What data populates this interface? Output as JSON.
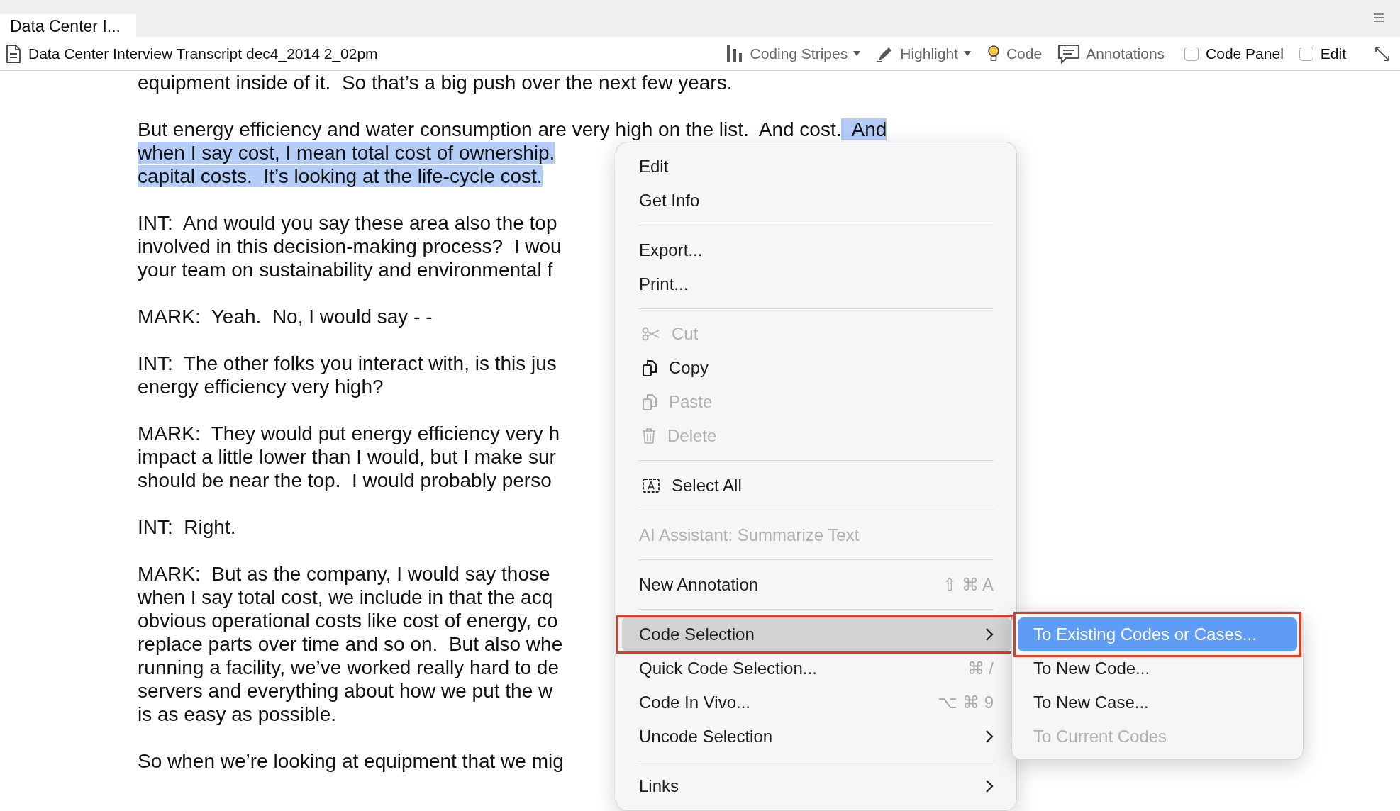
{
  "tab": {
    "title": "Data Center I..."
  },
  "toolbar": {
    "document_title": "Data Center Interview Transcript dec4_2014 2_02pm",
    "tools": [
      {
        "kind": "stripes",
        "label": "Coding Stripes",
        "dropdown": true
      },
      {
        "kind": "highlight",
        "label": "Highlight",
        "dropdown": true
      },
      {
        "kind": "code",
        "label": "Code",
        "dropdown": false
      },
      {
        "kind": "annotations",
        "label": "Annotations",
        "dropdown": false
      }
    ],
    "checkboxes": [
      {
        "label": "Code Panel",
        "checked": false
      },
      {
        "label": "Edit",
        "checked": false
      }
    ]
  },
  "transcript": [
    {
      "lines": [
        [
          {
            "text": "equipment inside of it.  So that’s a big push over the next few years.",
            "highlighted": false
          }
        ]
      ]
    },
    {
      "lines": [
        [
          {
            "text": "But energy efficiency and water consumption are very high on the list.  And cost.",
            "highlighted": false
          },
          {
            "text": "  And",
            "highlighted": true
          }
        ],
        [
          {
            "text": "when I say cost, I mean total cost of ownership.",
            "highlighted": true
          }
        ],
        [
          {
            "text": "capital costs.  It’s looking at the life-cycle cost.",
            "highlighted": true
          }
        ]
      ]
    },
    {
      "lines": [
        [
          {
            "text": "INT:  And would you say these area also the top",
            "highlighted": false
          }
        ],
        [
          {
            "text": "involved in this decision-making process?  I wou",
            "highlighted": false
          }
        ],
        [
          {
            "text": "your team on sustainability and environmental f",
            "highlighted": false
          }
        ]
      ]
    },
    {
      "lines": [
        [
          {
            "text": "MARK:  Yeah.  No, I would say - -",
            "highlighted": false
          }
        ]
      ]
    },
    {
      "lines": [
        [
          {
            "text": "INT:  The other folks you interact with, is this jus",
            "highlighted": false
          }
        ],
        [
          {
            "text": "energy efficiency very high?",
            "highlighted": false
          }
        ]
      ]
    },
    {
      "lines": [
        [
          {
            "text": "MARK:  They would put energy efficiency very h",
            "highlighted": false
          }
        ],
        [
          {
            "text": "impact a little lower than I would, but I make sur",
            "highlighted": false
          }
        ],
        [
          {
            "text": "should be near the top.  I would probably perso",
            "highlighted": false
          }
        ]
      ]
    },
    {
      "lines": [
        [
          {
            "text": "INT:  Right.",
            "highlighted": false
          }
        ]
      ]
    },
    {
      "lines": [
        [
          {
            "text": "MARK:  But as the company, I would say those",
            "highlighted": false
          }
        ],
        [
          {
            "text": "when I say total cost, we include in that the acq",
            "highlighted": false
          }
        ],
        [
          {
            "text": "obvious operational costs like cost of energy, co",
            "highlighted": false
          }
        ],
        [
          {
            "text": "replace parts over time and so on.  But also whe",
            "highlighted": false
          }
        ],
        [
          {
            "text": "running a facility, we’ve worked really hard to de",
            "highlighted": false
          }
        ],
        [
          {
            "text": "servers and everything about how we put the w",
            "highlighted": false
          }
        ],
        [
          {
            "text": "is as easy as possible.",
            "highlighted": false
          }
        ]
      ]
    },
    {
      "lines": [
        [
          {
            "text": "So when we’re looking at equipment that we mig",
            "highlighted": false
          }
        ]
      ]
    }
  ],
  "context_menu": {
    "items": [
      {
        "kind": "item",
        "label": "Edit",
        "disabled": false,
        "selected": false
      },
      {
        "kind": "item",
        "label": "Get Info",
        "disabled": false,
        "selected": false
      },
      {
        "kind": "separator"
      },
      {
        "kind": "item",
        "label": "Export...",
        "disabled": false,
        "selected": false
      },
      {
        "kind": "item",
        "label": "Print...",
        "disabled": false,
        "selected": false
      },
      {
        "kind": "separator"
      },
      {
        "kind": "icon_item",
        "label": "Cut",
        "disabled": true,
        "selected": false
      },
      {
        "kind": "icon_item",
        "label": "Copy",
        "disabled": false,
        "selected": false
      },
      {
        "kind": "icon_item",
        "label": "Paste",
        "disabled": true,
        "selected": false
      },
      {
        "kind": "icon_item",
        "label": "Delete",
        "disabled": true,
        "selected": false
      },
      {
        "kind": "separator"
      },
      {
        "kind": "icon_item",
        "label": "Select All",
        "disabled": false,
        "selected": false
      },
      {
        "kind": "separator"
      },
      {
        "kind": "item",
        "label": "AI Assistant: Summarize Text",
        "disabled": true,
        "selected": false
      },
      {
        "kind": "separator"
      },
      {
        "kind": "item",
        "label": "New Annotation",
        "disabled": false,
        "selected": false,
        "shortcut": "⇧ ⌘ A"
      },
      {
        "kind": "separator"
      },
      {
        "kind": "item",
        "label": "Code Selection",
        "disabled": false,
        "selected": true,
        "submenu": true,
        "outlined": true
      },
      {
        "kind": "item",
        "label": "Quick Code Selection...",
        "disabled": false,
        "selected": false,
        "shortcut": "⌘ /"
      },
      {
        "kind": "item",
        "label": "Code In Vivo...",
        "disabled": false,
        "selected": false,
        "shortcut": "⌥ ⌘ 9"
      },
      {
        "kind": "item",
        "label": "Uncode Selection",
        "disabled": false,
        "selected": false,
        "submenu": true
      },
      {
        "kind": "separator"
      },
      {
        "kind": "item",
        "label": "Links",
        "disabled": false,
        "selected": false,
        "submenu": true
      }
    ]
  },
  "submenu": {
    "items": [
      {
        "label": "To Existing Codes or Cases...",
        "disabled": false,
        "selected": true,
        "outlined": true
      },
      {
        "label": "To New Code...",
        "disabled": false,
        "selected": false
      },
      {
        "label": "To New Case...",
        "disabled": false,
        "selected": false
      },
      {
        "label": "To Current Codes",
        "disabled": true,
        "selected": false
      }
    ]
  }
}
